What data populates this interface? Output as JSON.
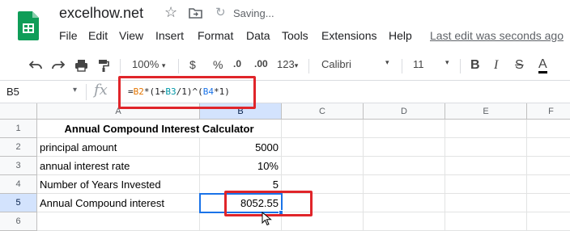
{
  "header": {
    "doc_title": "excelhow.net",
    "saving": "Saving...",
    "last_edit": "Last edit was seconds ago"
  },
  "menu": [
    "File",
    "Edit",
    "View",
    "Insert",
    "Format",
    "Data",
    "Tools",
    "Extensions",
    "Help"
  ],
  "toolbar": {
    "zoom": "100%",
    "currency": "$",
    "percent": "%",
    "dec_decrease": ".0",
    "dec_increase": ".00",
    "format_more": "123",
    "font": "Calibri",
    "font_size": "11",
    "bold": "B",
    "italic": "I",
    "strike": "S",
    "text_color": "A"
  },
  "formula_bar": {
    "name_box": "B5",
    "fx": "fx",
    "formula_parts": [
      "=",
      "B2",
      "*(1+",
      "B3",
      "/1)^(",
      "B4",
      "*1)"
    ]
  },
  "columns": [
    "A",
    "B",
    "C",
    "D",
    "E",
    "F"
  ],
  "rows": [
    "1",
    "2",
    "3",
    "4",
    "5",
    "6"
  ],
  "cells": {
    "A1": "Annual Compound Interest Calculator",
    "A2": "principal amount",
    "B2": "5000",
    "A3": "annual interest rate",
    "B3": "10%",
    "A4": "Number of Years Invested",
    "B4": "5",
    "A5": "Annual Compound interest",
    "B5": "8052.55"
  },
  "colors": {
    "accent": "#1a73e8",
    "annotation_red": "#e0252a",
    "sheets_green": "#0f9d58"
  },
  "icons": [
    "sheets-logo-icon",
    "star-icon",
    "move-folder-icon",
    "sync-icon",
    "undo-icon",
    "redo-icon",
    "print-icon",
    "paint-format-icon",
    "text-color-icon",
    "mouse-cursor-icon"
  ]
}
